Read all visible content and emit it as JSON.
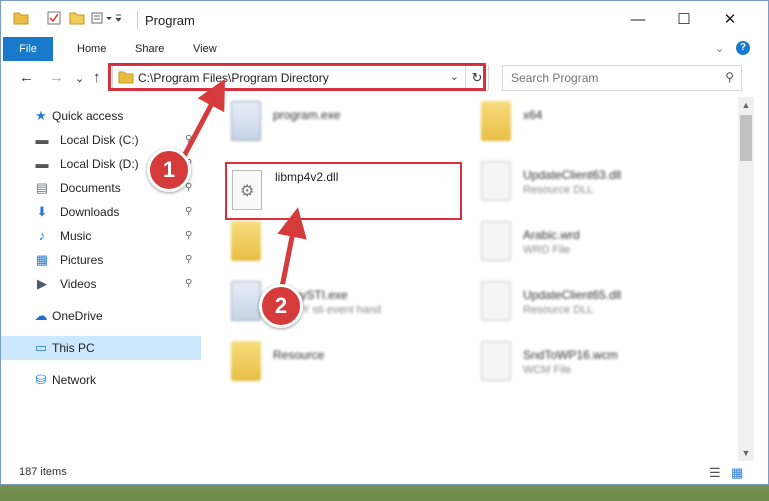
{
  "window": {
    "title": "Program",
    "controls": {
      "minimize": "—",
      "maximize": "☐",
      "close": "✕"
    }
  },
  "ribbon": {
    "tabs": [
      "File",
      "Home",
      "Share",
      "View"
    ],
    "expand_icon": "⌄",
    "help_icon": "?"
  },
  "nav": {
    "back": "←",
    "forward": "→",
    "recent": "⌄",
    "up": "↑"
  },
  "address": {
    "path": "C:\\Program Files\\Program Directory",
    "dropdown": "⌄",
    "refresh": "↻"
  },
  "search": {
    "placeholder": "Search Program",
    "icon": "⚲"
  },
  "sidebar": {
    "items": [
      {
        "label": "Quick access",
        "icon": "★",
        "pinned": false,
        "selected": false
      },
      {
        "label": "Local Disk (C:)",
        "icon": "▬",
        "pinned": true,
        "selected": false
      },
      {
        "label": "Local Disk (D:)",
        "icon": "▬",
        "pinned": true,
        "selected": false
      },
      {
        "label": "Documents",
        "icon": "▤",
        "pinned": true,
        "selected": false
      },
      {
        "label": "Downloads",
        "icon": "⬇",
        "pinned": true,
        "selected": false
      },
      {
        "label": "Music",
        "icon": "♪",
        "pinned": true,
        "selected": false
      },
      {
        "label": "Pictures",
        "icon": "▦",
        "pinned": true,
        "selected": false
      },
      {
        "label": "Videos",
        "icon": "▶",
        "pinned": true,
        "selected": false
      },
      {
        "label": "OneDrive",
        "icon": "☁",
        "pinned": false,
        "selected": false
      },
      {
        "label": "This PC",
        "icon": "▭",
        "pinned": false,
        "selected": true
      },
      {
        "label": "Network",
        "icon": "⛁",
        "pinned": false,
        "selected": false
      }
    ],
    "pin_icon": "📌"
  },
  "files": {
    "left": [
      {
        "name": "program.exe",
        "type": ""
      },
      {
        "name": "",
        "type": ""
      },
      {
        "name": "",
        "type": ""
      },
      {
        "name": "AbbyySTI.exe",
        "type": "ABBYY sti event hand"
      },
      {
        "name": "Resource",
        "type": ""
      }
    ],
    "right": [
      {
        "name": "x64",
        "type": ""
      },
      {
        "name": "UpdateClient63.dll",
        "type": "Resource DLL"
      },
      {
        "name": "Arabic.wrd",
        "type": "WRD File"
      },
      {
        "name": "UpdateClient65.dll",
        "type": "Resource DLL"
      },
      {
        "name": "SndToWP16.wcm",
        "type": "WCM File"
      }
    ],
    "featured": {
      "name": "libmp4v2.dll",
      "icon": "⚙"
    }
  },
  "callouts": [
    "1",
    "2"
  ],
  "status": {
    "count": "187 items",
    "details_view_icon": "☰",
    "large_icons_view_icon": "▦"
  },
  "colors": {
    "accent": "#1979ca",
    "highlight": "#d9303f",
    "selection": "#cce8ff"
  }
}
